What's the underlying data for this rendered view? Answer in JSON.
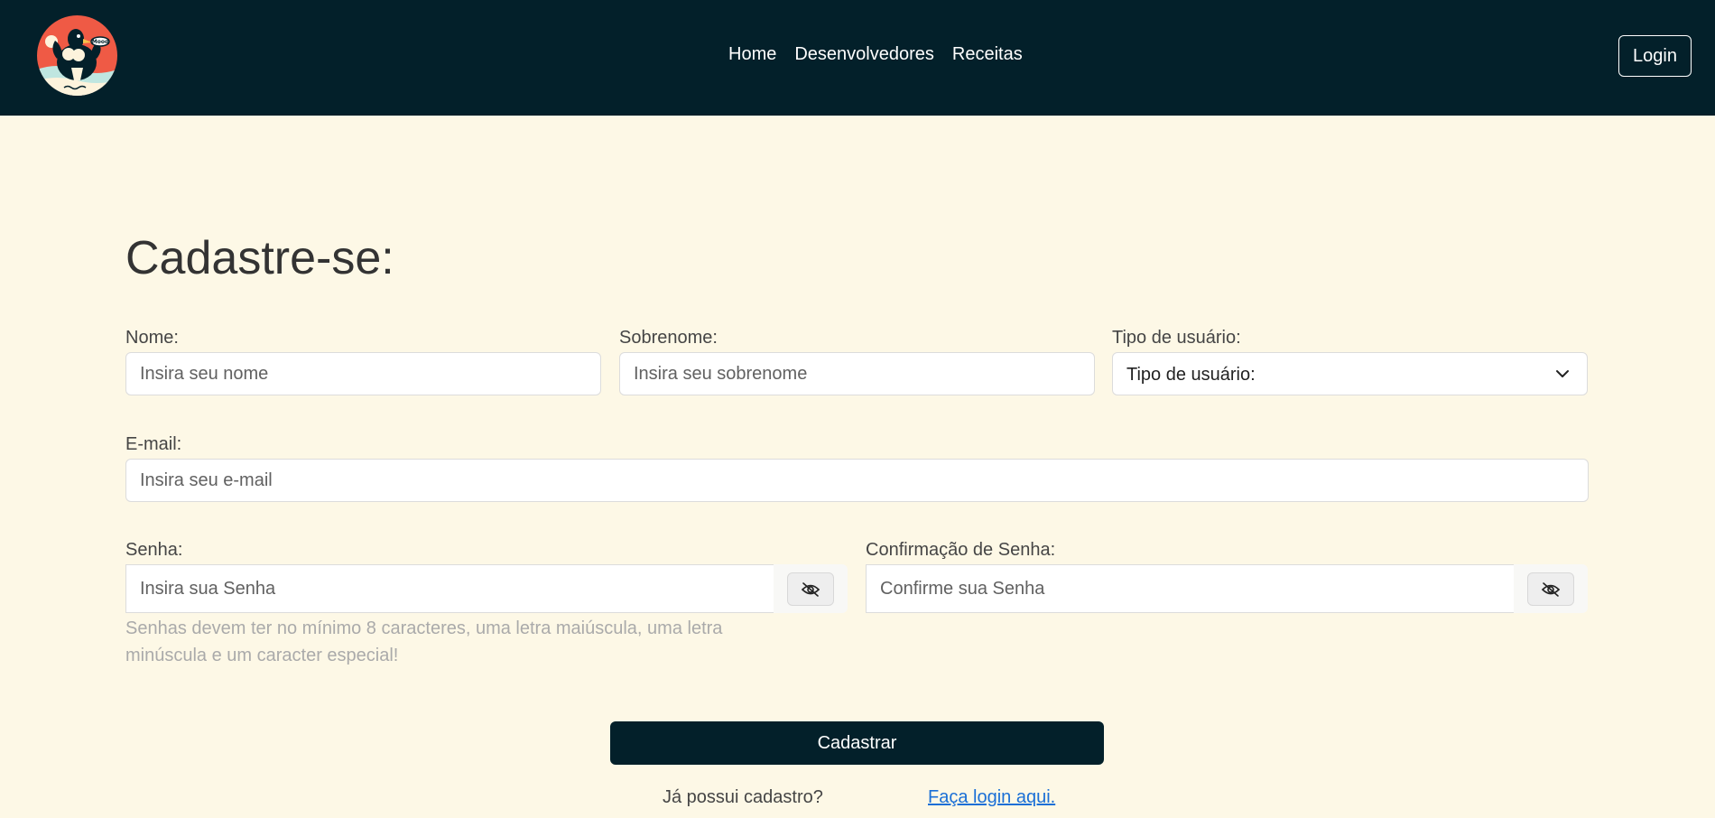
{
  "navbar": {
    "links": [
      {
        "label": "Home"
      },
      {
        "label": "Desenvolvedores"
      },
      {
        "label": "Receitas"
      }
    ],
    "login_label": "Login",
    "background_color": "#03202a"
  },
  "logo": {
    "icon": "muscular-seagull-mascot-logo",
    "badge_text": "Mood"
  },
  "form": {
    "title": "Cadastre-se:",
    "nome": {
      "label": "Nome:",
      "placeholder": "Insira seu nome"
    },
    "sobrenome": {
      "label": "Sobrenome:",
      "placeholder": "Insira seu sobrenome"
    },
    "tipo": {
      "label": "Tipo de usuário:",
      "selected": "Tipo de usuário:"
    },
    "email": {
      "label": "E-mail:",
      "placeholder": "Insira seu e-mail"
    },
    "senha": {
      "label": "Senha:",
      "placeholder": "Insira sua Senha"
    },
    "confirmacao": {
      "label": "Confirmação de Senha:",
      "placeholder": "Confirme sua Senha"
    },
    "password_hint": "Senhas devem ter no mínimo 8 caracteres, uma letra maiúscula, uma letra minúscula e um caracter especial!",
    "submit_label": "Cadastrar",
    "already_registered": "Já possui cadastro?",
    "login_link": "Faça login aqui."
  },
  "colors": {
    "page_background": "#fdf8e6",
    "primary_dark": "#03202a",
    "logo_accent": "#ef5a45",
    "link": "#1a6fd6"
  }
}
